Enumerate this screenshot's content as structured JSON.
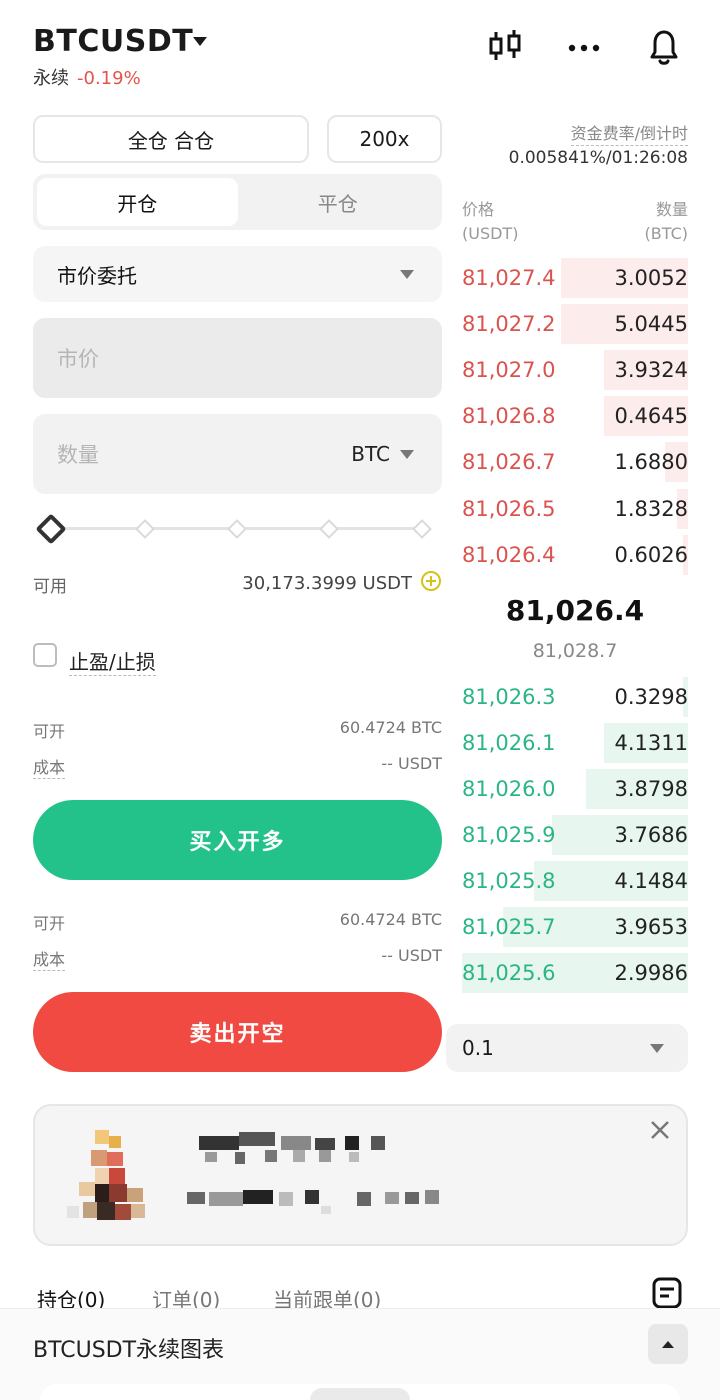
{
  "header": {
    "symbol": "BTCUSDT",
    "contract_type": "永续",
    "change_percent": "-0.19%"
  },
  "controls": {
    "margin_mode": "全仓 合仓",
    "leverage": "200x",
    "funding_label": "资金费率/倒计时",
    "funding_value": "0.005841%/01:26:08"
  },
  "tabs": {
    "open": "开仓",
    "close": "平仓"
  },
  "order_type": "市价委托",
  "price_field": {
    "placeholder": "市价"
  },
  "qty_field": {
    "placeholder": "数量",
    "unit": "BTC"
  },
  "available": {
    "label": "可用",
    "value": "30,173.3999 USDT"
  },
  "tpsl": {
    "label": "止盈/止损"
  },
  "buy_section": {
    "can_open_label": "可开",
    "can_open_value": "60.4724 BTC",
    "cost_label": "成本",
    "cost_value": "-- USDT",
    "button": "买入开多"
  },
  "sell_section": {
    "can_open_label": "可开",
    "can_open_value": "60.4724 BTC",
    "cost_label": "成本",
    "cost_value": "-- USDT",
    "button": "卖出开空"
  },
  "orderbook": {
    "price_header": "价格",
    "price_unit": "(USDT)",
    "qty_header": "数量",
    "qty_unit": "(BTC)",
    "asks": [
      {
        "price": "81,027.4",
        "qty": "3.0052",
        "depth": 0.56
      },
      {
        "price": "81,027.2",
        "qty": "5.0445",
        "depth": 0.56
      },
      {
        "price": "81,027.0",
        "qty": "3.9324",
        "depth": 0.37
      },
      {
        "price": "81,026.8",
        "qty": "0.4645",
        "depth": 0.37
      },
      {
        "price": "81,026.7",
        "qty": "1.6880",
        "depth": 0.1
      },
      {
        "price": "81,026.5",
        "qty": "1.8328",
        "depth": 0.05
      },
      {
        "price": "81,026.4",
        "qty": "0.6026",
        "depth": 0.02
      }
    ],
    "last_price": "81,026.4",
    "mark_price": "81,028.7",
    "bids": [
      {
        "price": "81,026.3",
        "qty": "0.3298",
        "depth": 0.02
      },
      {
        "price": "81,026.1",
        "qty": "4.1311",
        "depth": 0.37
      },
      {
        "price": "81,026.0",
        "qty": "3.8798",
        "depth": 0.45
      },
      {
        "price": "81,025.9",
        "qty": "3.7686",
        "depth": 0.6
      },
      {
        "price": "81,025.8",
        "qty": "4.1484",
        "depth": 0.68
      },
      {
        "price": "81,025.7",
        "qty": "3.9653",
        "depth": 0.82
      },
      {
        "price": "81,025.6",
        "qty": "2.9986",
        "depth": 1.0
      }
    ],
    "precision": "0.1"
  },
  "bottom_tabs": {
    "positions": "持仓(0)",
    "orders": "订单(0)",
    "copy_orders": "当前跟单(0)"
  },
  "footer": {
    "title": "BTCUSDT永续图表"
  },
  "colors": {
    "buy": "#22c28a",
    "sell": "#f04a42",
    "bid_text": "#2bb585",
    "ask_text": "#d9534f"
  }
}
